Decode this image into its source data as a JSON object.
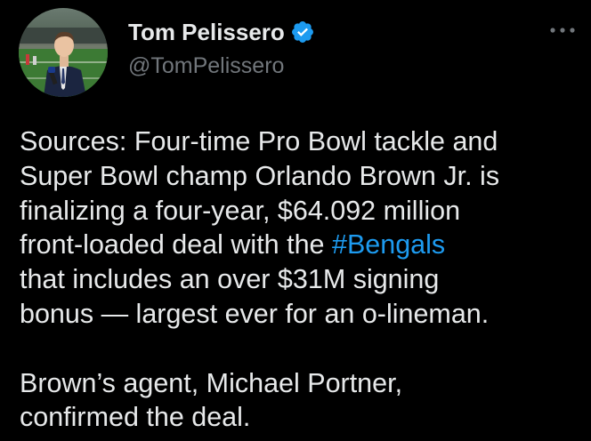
{
  "author": {
    "display_name": "Tom Pelissero",
    "handle": "@TomPelissero",
    "verified": true
  },
  "tweet": {
    "line1": "Sources: Four-time Pro Bowl tackle and",
    "line2": "Super Bowl champ Orlando Brown Jr. is",
    "line3": "finalizing a four-year, $64.092 million",
    "line4_pre": "front-loaded deal with the ",
    "hashtag": "#Bengals",
    "line5": "that includes an over $31M signing",
    "line6": "bonus — largest ever for an o-lineman.",
    "line7": "Brown’s agent, Michael Portner,",
    "line8": "confirmed the deal."
  },
  "colors": {
    "background": "#000000",
    "text": "#e7e9ea",
    "secondary": "#71767b",
    "link": "#1d9bf0",
    "verified": "#1d9bf0"
  },
  "icons": {
    "more": "more-horizontal-icon",
    "verified": "verified-badge-icon"
  }
}
